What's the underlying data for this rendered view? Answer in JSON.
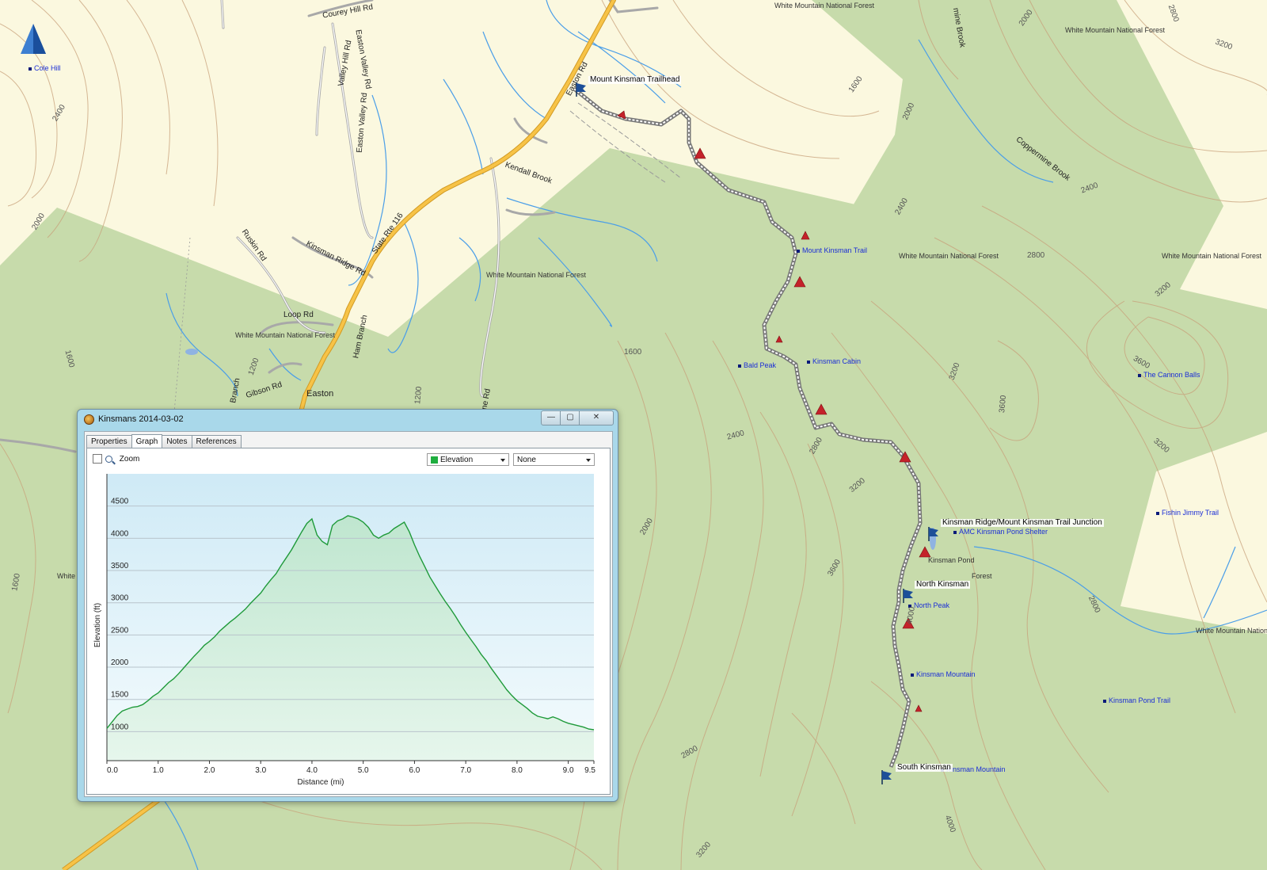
{
  "map": {
    "colors": {
      "background": "#fbf8df",
      "forest": "#c7dbab",
      "water": "#4a9ee8",
      "highway": "#f2b42f",
      "road": "#9a9a9a",
      "contour": "#c8a07a"
    },
    "compass": "north-arrow-icon",
    "labels": {
      "cole_hill": "Cole Hill",
      "wmnf_top": "White Mountain National Forest",
      "wmnf_top_right": "White Mountain National Forest",
      "wmnf_mid": "White Mountain National Forest",
      "wmnf_left": "White Mountain National Forest",
      "wmnf_east": "White Mountain National Forest",
      "wmnf_far_right": "White Mountain National Forest",
      "wmnf_far_right_low": "White Mountain National Forest",
      "wmnf_left_cut": "White M",
      "courey_hill_rd": "Courey Hill Rd",
      "valley_hill_rd": "Valley Hill Rd",
      "easton_valley_rd": "Easton Valley Rd",
      "easton_valley_rd2": "Easton Valley Rd",
      "easton_rd": "Easton Rd",
      "kendall_brook": "Kendall Brook",
      "state_rte_116": "State Rte 116",
      "ruskin_rd": "Ruskin Rd",
      "kinsman_ridge_rd": "Kinsman Ridge Rd",
      "loop_rd": "Loop Rd",
      "ham_branch": "Ham Branch",
      "gibson_rd": "Gibson Rd",
      "branch": "Branch",
      "easton": "Easton",
      "ine_rd": "ine Rd",
      "coppermine_brook": "Coppermine Brook",
      "mine_brook": "mine Brook",
      "mount_kinsman_trail": "Mount Kinsman Trail",
      "kinsman_cabin": "Kinsman Cabin",
      "bald_peak": "Bald Peak",
      "the_cannon_balls": "The Cannon Balls",
      "fishin_jimmy_trail": "Fishin Jimmy Trail",
      "amc_shelter": "AMC Kinsman Pond Shelter",
      "kinsman_pond": "Kinsman Pond",
      "north_peak": "North Peak",
      "kinsman_mountain": "Kinsman Mountain",
      "kinsman_mountain2": "Kinsman Mountain",
      "kinsman_pond_trail": "Kinsman Pond Trail",
      "forest_cut": "Forest"
    },
    "contours": {
      "c2400a": "2400",
      "c2000a": "2000",
      "c1600a": "1600",
      "c1200a": "1200",
      "c1200b": "1200",
      "c1600b": "1600",
      "c2800a": "2800",
      "c2400b": "2400",
      "c2000b": "2000",
      "c1600c": "1600",
      "c2000c": "2000",
      "c2400c": "2400",
      "c2800b": "2800",
      "c3200a": "3200",
      "c3600a": "3600",
      "c2800c": "2800",
      "c3200b": "3200",
      "c2000d": "2000",
      "c2400d": "2400",
      "c2800d": "2800",
      "c3200c": "3200",
      "c3200d": "3200",
      "c3600b": "3600",
      "c3200e": "3200",
      "c3600c": "3600",
      "c3200f": "3200",
      "c2800e": "2800",
      "c4000a": "4000",
      "c4000b": "4000",
      "c2800f": "2800",
      "c3200g": "3200",
      "c1600d": "1600",
      "c2800g": "2800"
    },
    "flags": {
      "trailhead": "Mount Kinsman Trailhead",
      "junction": "Kinsman Ridge/Mount Kinsman Trail Junction",
      "north_kinsman": "North Kinsman",
      "south_kinsman": "South Kinsman"
    }
  },
  "window": {
    "title": "Kinsmans 2014-03-02",
    "icon": "track-icon",
    "controls": {
      "minimize": "—",
      "maximize": "▢",
      "close": "✕"
    },
    "tabs": [
      "Properties",
      "Graph",
      "Notes",
      "References"
    ],
    "active_tab": "Graph",
    "zoom_label": "Zoom",
    "zoom_checked": false,
    "primary_dropdown": "Elevation",
    "secondary_dropdown": "None"
  },
  "chart_data": {
    "type": "line",
    "title": "",
    "xlabel": "Distance (mi)",
    "ylabel": "Elevation (ft)",
    "xlim": [
      0,
      9.5
    ],
    "ylim": [
      550,
      5000
    ],
    "xticks": [
      "0.0",
      "1.0",
      "2.0",
      "3.0",
      "4.0",
      "5.0",
      "6.0",
      "7.0",
      "8.0",
      "9.0",
      "9.5"
    ],
    "yticks": [
      1000,
      1500,
      2000,
      2500,
      3000,
      3500,
      4000,
      4500
    ],
    "grid": true,
    "line_color": "#1f9a3a",
    "series": [
      {
        "name": "Elevation",
        "x": [
          0.0,
          0.1,
          0.2,
          0.3,
          0.4,
          0.5,
          0.6,
          0.7,
          0.8,
          0.9,
          1.0,
          1.1,
          1.2,
          1.3,
          1.4,
          1.5,
          1.6,
          1.7,
          1.8,
          1.9,
          2.0,
          2.1,
          2.2,
          2.3,
          2.4,
          2.5,
          2.6,
          2.7,
          2.8,
          2.9,
          3.0,
          3.1,
          3.2,
          3.3,
          3.4,
          3.5,
          3.6,
          3.7,
          3.8,
          3.9,
          4.0,
          4.1,
          4.2,
          4.3,
          4.4,
          4.5,
          4.6,
          4.7,
          4.8,
          4.9,
          5.0,
          5.1,
          5.2,
          5.3,
          5.4,
          5.5,
          5.6,
          5.7,
          5.8,
          5.9,
          6.0,
          6.1,
          6.2,
          6.3,
          6.4,
          6.5,
          6.6,
          6.7,
          6.8,
          6.9,
          7.0,
          7.1,
          7.2,
          7.3,
          7.4,
          7.5,
          7.6,
          7.7,
          7.8,
          7.9,
          8.0,
          8.1,
          8.2,
          8.3,
          8.4,
          8.5,
          8.6,
          8.7,
          8.8,
          8.9,
          9.0,
          9.1,
          9.2,
          9.3,
          9.4,
          9.5
        ],
        "y": [
          1050,
          1150,
          1250,
          1320,
          1350,
          1380,
          1390,
          1420,
          1480,
          1550,
          1600,
          1680,
          1760,
          1820,
          1900,
          1990,
          2080,
          2170,
          2250,
          2340,
          2400,
          2470,
          2560,
          2630,
          2700,
          2760,
          2830,
          2900,
          2990,
          3070,
          3150,
          3260,
          3360,
          3450,
          3580,
          3700,
          3820,
          3960,
          4100,
          4230,
          4300,
          4050,
          3950,
          3900,
          4200,
          4270,
          4300,
          4350,
          4330,
          4300,
          4250,
          4170,
          4050,
          4000,
          4050,
          4080,
          4150,
          4200,
          4250,
          4100,
          3900,
          3720,
          3560,
          3400,
          3270,
          3140,
          3020,
          2910,
          2790,
          2660,
          2540,
          2430,
          2320,
          2200,
          2100,
          1980,
          1870,
          1760,
          1650,
          1560,
          1480,
          1420,
          1360,
          1290,
          1240,
          1220,
          1200,
          1230,
          1200,
          1160,
          1130,
          1110,
          1090,
          1070,
          1040,
          1030
        ]
      }
    ]
  }
}
